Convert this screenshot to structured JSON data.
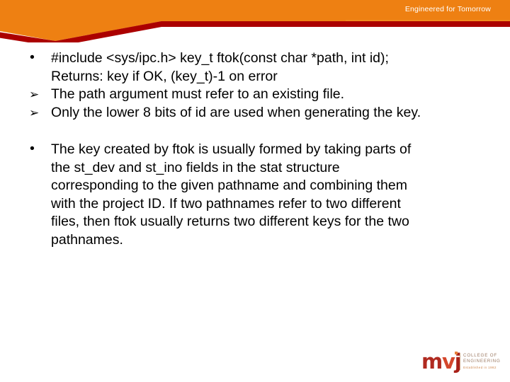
{
  "colors": {
    "orange": "#EE8012",
    "dark_red": "#AB0000",
    "white": "#FFFFFF",
    "body_text": "#000000",
    "logo_red": "#B02A20",
    "logo_orange": "#D4472C",
    "logo_tagline": "#9B7A63",
    "logo_established": "#D08A52"
  },
  "header": {
    "tagline": "Engineered for Tomorrow"
  },
  "slide": {
    "blocks": [
      {
        "marker": "bullet-dot",
        "marker_glyph": "•",
        "lines": [
          "#include <sys/ipc.h> key_t ftok(const char *path, int id);",
          "Returns: key if OK, (key_t)-1 on error"
        ]
      },
      {
        "marker": "arrow-bullet",
        "marker_glyph": "➢",
        "lines": [
          "The path argument must refer to an existing file."
        ]
      },
      {
        "marker": "arrow-bullet",
        "marker_glyph": "➢",
        "lines": [
          " Only the lower 8 bits of id are used when generating the key."
        ]
      },
      {
        "marker": "bullet-dot",
        "marker_glyph": "•",
        "lines": [
          "The key created by ftok is usually formed by taking parts of",
          "the st_dev and st_ino fields in the stat structure",
          "corresponding to the given pathname and combining them",
          "with the project ID. If two pathnames refer to two different",
          "files, then ftok usually returns two different keys for the two",
          "pathnames."
        ]
      }
    ]
  },
  "footer": {
    "logo": {
      "mark_m": "m",
      "mark_v": "v",
      "mark_j": "j",
      "line1": "COLLEGE OF",
      "line2": "ENGINEERING",
      "line3": "Established in 1982"
    }
  }
}
